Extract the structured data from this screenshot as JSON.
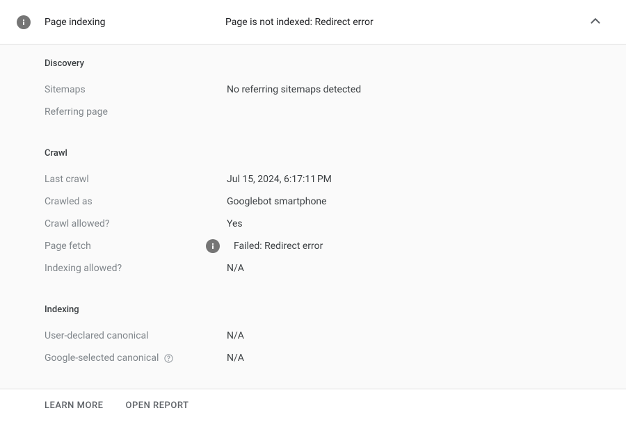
{
  "header": {
    "title": "Page indexing",
    "status": "Page is not indexed: Redirect error"
  },
  "sections": {
    "discovery": {
      "heading": "Discovery",
      "sitemaps_label": "Sitemaps",
      "sitemaps_value": "No referring sitemaps detected",
      "referring_page_label": "Referring page",
      "referring_page_value": ""
    },
    "crawl": {
      "heading": "Crawl",
      "last_crawl_label": "Last crawl",
      "last_crawl_value": "Jul 15, 2024, 6:17:11 PM",
      "crawled_as_label": "Crawled as",
      "crawled_as_value": "Googlebot smartphone",
      "crawl_allowed_label": "Crawl allowed?",
      "crawl_allowed_value": "Yes",
      "page_fetch_label": "Page fetch",
      "page_fetch_value": "Failed: Redirect error",
      "indexing_allowed_label": "Indexing allowed?",
      "indexing_allowed_value": "N/A"
    },
    "indexing": {
      "heading": "Indexing",
      "user_canonical_label": "User-declared canonical",
      "user_canonical_value": "N/A",
      "google_canonical_label": "Google-selected canonical",
      "google_canonical_value": "N/A"
    }
  },
  "footer": {
    "learn_more": "Learn more",
    "open_report": "Open report"
  }
}
